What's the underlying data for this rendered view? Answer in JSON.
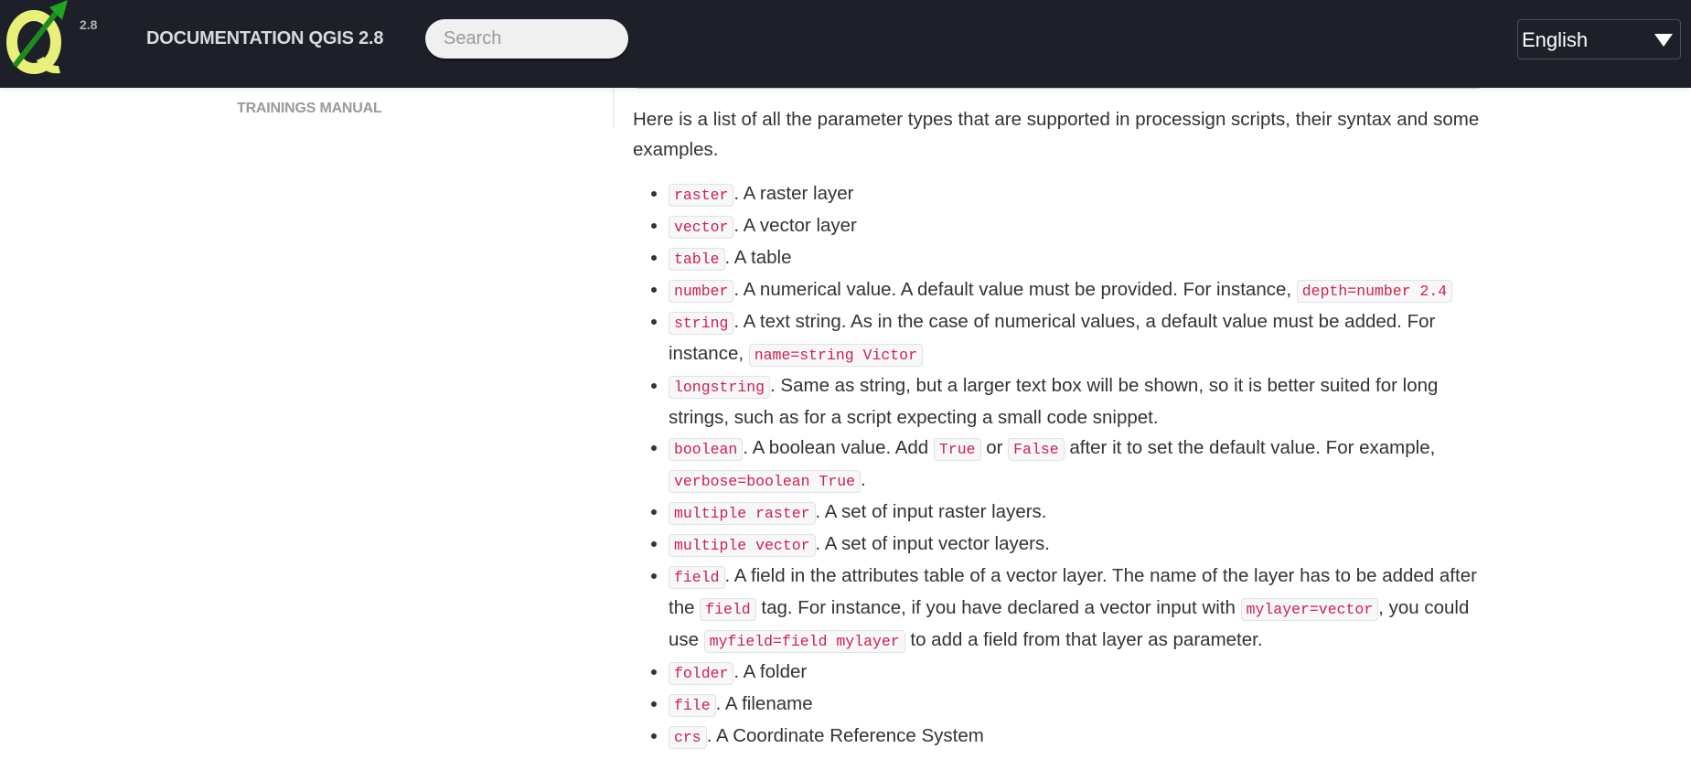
{
  "header": {
    "logo": "qgis-logo",
    "version": "2.8",
    "title": "DOCUMENTATION QGIS 2.8",
    "search_placeholder": "Search",
    "language": "English"
  },
  "sidebar": {
    "link": "TRAININGS MANUAL"
  },
  "colors": {
    "topbar": "#1d2029",
    "code_text": "#c7254e",
    "body_text": "#333333"
  },
  "content": {
    "intro": "Here is a list of all the parameter types that are supported in processign scripts, their syntax and some examples.",
    "items": [
      {
        "code": "raster",
        "text": ". A raster layer"
      },
      {
        "code": "vector",
        "text": ". A vector layer"
      },
      {
        "code": "table",
        "text": ". A table"
      },
      {
        "code": "number",
        "text": ". A numerical value. A default value must be provided. For instance, ",
        "code2": "depth=number 2.4"
      },
      {
        "code": "string",
        "text": ". A text string. As in the case of numerical values, a default value must be added. For instance, ",
        "code2": "name=string Victor"
      },
      {
        "code": "longstring",
        "text": ". Same as string, but a larger text box will be shown, so it is better suited for long strings, such as for a script expecting a small code snippet."
      },
      {
        "code": "boolean",
        "text": ". A boolean value. Add ",
        "code2": "True",
        "text2": " or ",
        "code3": "False",
        "text3": " after it to set the default value. For example, ",
        "code4": "verbose=boolean True",
        "text4": "."
      },
      {
        "code": "multiple raster",
        "text": ". A set of input raster layers."
      },
      {
        "code": "multiple vector",
        "text": ". A set of input vector layers."
      },
      {
        "code": "field",
        "text": ". A field in the attributes table of a vector layer. The name of the layer has to be added after the ",
        "code2": "field",
        "text2": " tag. For instance, if you have declared a vector input with ",
        "code3": "mylayer=vector",
        "text3": ", you could use ",
        "code4": "myfield=field mylayer",
        "text4": " to add a field from that layer as parameter."
      },
      {
        "code": "folder",
        "text": ". A folder"
      },
      {
        "code": "file",
        "text": ". A filename"
      },
      {
        "code": "crs",
        "text": ". A Coordinate Reference System"
      }
    ]
  }
}
